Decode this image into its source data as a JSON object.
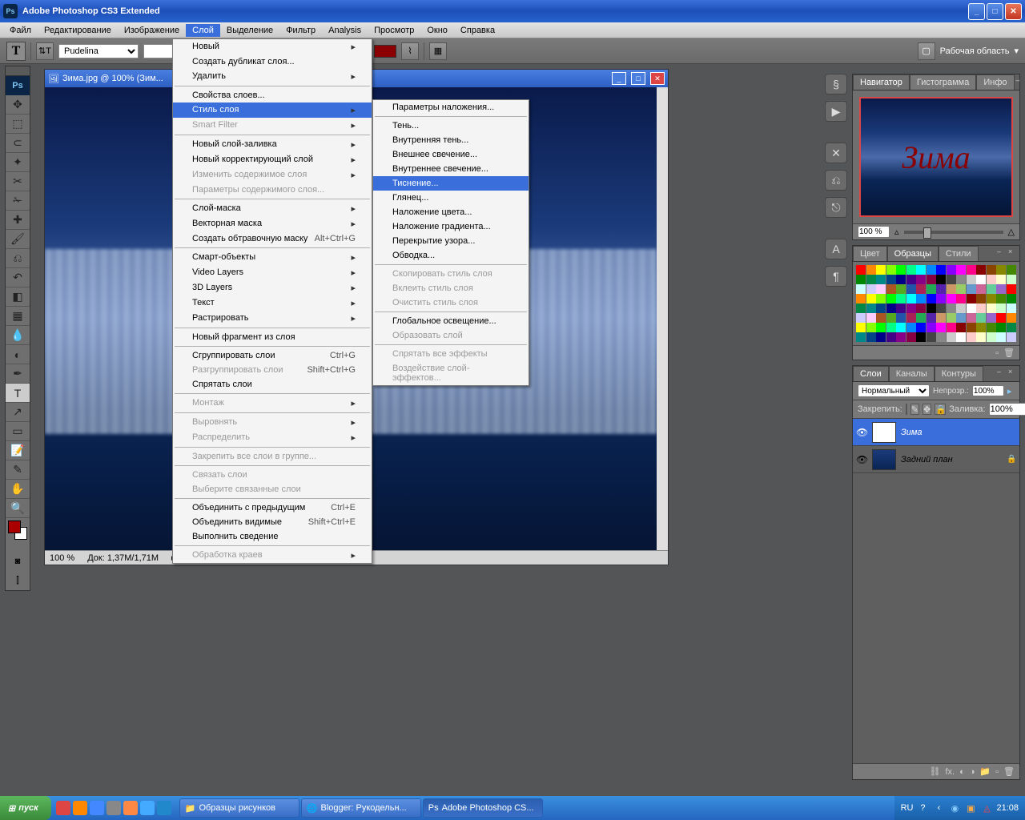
{
  "titlebar": {
    "app": "Adobe Photoshop CS3 Extended"
  },
  "menubar": [
    "Файл",
    "Редактирование",
    "Изображение",
    "Слой",
    "Выделение",
    "Фильтр",
    "Analysis",
    "Просмотр",
    "Окно",
    "Справка"
  ],
  "menubar_active": 3,
  "optbar": {
    "font": "Pudelina",
    "workspace": "Рабочая область"
  },
  "docwin": {
    "title": "Зима.jpg @ 100% (Зим...",
    "zoom": "100 %",
    "docsize": "Док: 1,37M/1,71M"
  },
  "menu1": [
    {
      "t": "item",
      "lbl": "Новый",
      "arr": true
    },
    {
      "t": "item",
      "lbl": "Создать дубликат слоя..."
    },
    {
      "t": "item",
      "lbl": "Удалить",
      "arr": true
    },
    {
      "t": "sep"
    },
    {
      "t": "item",
      "lbl": "Свойства слоев..."
    },
    {
      "t": "item",
      "lbl": "Стиль слоя",
      "arr": true,
      "hl": true
    },
    {
      "t": "item",
      "lbl": "Smart Filter",
      "arr": true,
      "dis": true
    },
    {
      "t": "sep"
    },
    {
      "t": "item",
      "lbl": "Новый слой-заливка",
      "arr": true
    },
    {
      "t": "item",
      "lbl": "Новый корректирующий слой",
      "arr": true
    },
    {
      "t": "item",
      "lbl": "Изменить содержимое слоя",
      "arr": true,
      "dis": true
    },
    {
      "t": "item",
      "lbl": "Параметры содержимого слоя...",
      "dis": true
    },
    {
      "t": "sep"
    },
    {
      "t": "item",
      "lbl": "Слой-маска",
      "arr": true
    },
    {
      "t": "item",
      "lbl": "Векторная маска",
      "arr": true
    },
    {
      "t": "item",
      "lbl": "Создать обтравочную маску",
      "sc": "Alt+Ctrl+G"
    },
    {
      "t": "sep"
    },
    {
      "t": "item",
      "lbl": "Смарт-объекты",
      "arr": true
    },
    {
      "t": "item",
      "lbl": "Video Layers",
      "arr": true
    },
    {
      "t": "item",
      "lbl": "3D Layers",
      "arr": true
    },
    {
      "t": "item",
      "lbl": "Текст",
      "arr": true
    },
    {
      "t": "item",
      "lbl": "Растрировать",
      "arr": true
    },
    {
      "t": "sep"
    },
    {
      "t": "item",
      "lbl": "Новый фрагмент из слоя"
    },
    {
      "t": "sep"
    },
    {
      "t": "item",
      "lbl": "Сгруппировать слои",
      "sc": "Ctrl+G"
    },
    {
      "t": "item",
      "lbl": "Разгруппировать слои",
      "sc": "Shift+Ctrl+G",
      "dis": true
    },
    {
      "t": "item",
      "lbl": "Спрятать слои"
    },
    {
      "t": "sep"
    },
    {
      "t": "item",
      "lbl": "Монтаж",
      "arr": true,
      "dis": true
    },
    {
      "t": "sep"
    },
    {
      "t": "item",
      "lbl": "Выровнять",
      "arr": true,
      "dis": true
    },
    {
      "t": "item",
      "lbl": "Распределить",
      "arr": true,
      "dis": true
    },
    {
      "t": "sep"
    },
    {
      "t": "item",
      "lbl": "Закрепить все слои в группе...",
      "dis": true
    },
    {
      "t": "sep"
    },
    {
      "t": "item",
      "lbl": "Связать слои",
      "dis": true
    },
    {
      "t": "item",
      "lbl": "Выберите связанные слои",
      "dis": true
    },
    {
      "t": "sep"
    },
    {
      "t": "item",
      "lbl": "Объединить с предыдущим",
      "sc": "Ctrl+E"
    },
    {
      "t": "item",
      "lbl": "Объединить видимые",
      "sc": "Shift+Ctrl+E"
    },
    {
      "t": "item",
      "lbl": "Выполнить сведение"
    },
    {
      "t": "sep"
    },
    {
      "t": "item",
      "lbl": "Обработка краев",
      "arr": true,
      "dis": true
    }
  ],
  "menu2": [
    {
      "t": "item",
      "lbl": "Параметры наложения..."
    },
    {
      "t": "sep"
    },
    {
      "t": "item",
      "lbl": "Тень..."
    },
    {
      "t": "item",
      "lbl": "Внутренняя тень..."
    },
    {
      "t": "item",
      "lbl": "Внешнее свечение..."
    },
    {
      "t": "item",
      "lbl": "Внутреннее свечение..."
    },
    {
      "t": "item",
      "lbl": "Тиснение...",
      "hl": true
    },
    {
      "t": "item",
      "lbl": "Глянец..."
    },
    {
      "t": "item",
      "lbl": "Наложение цвета..."
    },
    {
      "t": "item",
      "lbl": "Наложение градиента..."
    },
    {
      "t": "item",
      "lbl": "Перекрытие узора..."
    },
    {
      "t": "item",
      "lbl": "Обводка..."
    },
    {
      "t": "sep"
    },
    {
      "t": "item",
      "lbl": "Скопировать стиль слоя",
      "dis": true
    },
    {
      "t": "item",
      "lbl": "Вклеить стиль слоя",
      "dis": true
    },
    {
      "t": "item",
      "lbl": "Очистить стиль слоя",
      "dis": true
    },
    {
      "t": "sep"
    },
    {
      "t": "item",
      "lbl": "Глобальное освещение..."
    },
    {
      "t": "item",
      "lbl": "Образовать слой",
      "dis": true
    },
    {
      "t": "sep"
    },
    {
      "t": "item",
      "lbl": "Спрятать все эффекты",
      "dis": true
    },
    {
      "t": "item",
      "lbl": "Воздействие слой-эффектов...",
      "dis": true
    }
  ],
  "nav": {
    "tabs": [
      "Навигатор",
      "Гистограмма",
      "Инфо"
    ],
    "text": "Зима",
    "zoom": "100 %"
  },
  "swatches": {
    "tabs": [
      "Цвет",
      "Образцы",
      "Стили"
    ]
  },
  "layers": {
    "tabs": [
      "Слои",
      "Каналы",
      "Контуры"
    ],
    "blend": "Нормальный",
    "opacity_lbl": "Непрозр.:",
    "opacity": "100%",
    "lock_lbl": "Закрепить:",
    "fill_lbl": "Заливка:",
    "fill": "100%",
    "items": [
      {
        "name": "Зима",
        "type": "text",
        "sel": true
      },
      {
        "name": "Задний план",
        "type": "img",
        "locked": true
      }
    ]
  },
  "taskbar": {
    "start": "пуск",
    "tasks": [
      {
        "lbl": "Образцы рисунков",
        "icon": "📁"
      },
      {
        "lbl": "Blogger: Рукодельн...",
        "icon": "🌐"
      },
      {
        "lbl": "Adobe Photoshop CS...",
        "icon": "Ps",
        "act": true
      }
    ],
    "lang": "RU",
    "time": "21:08"
  }
}
